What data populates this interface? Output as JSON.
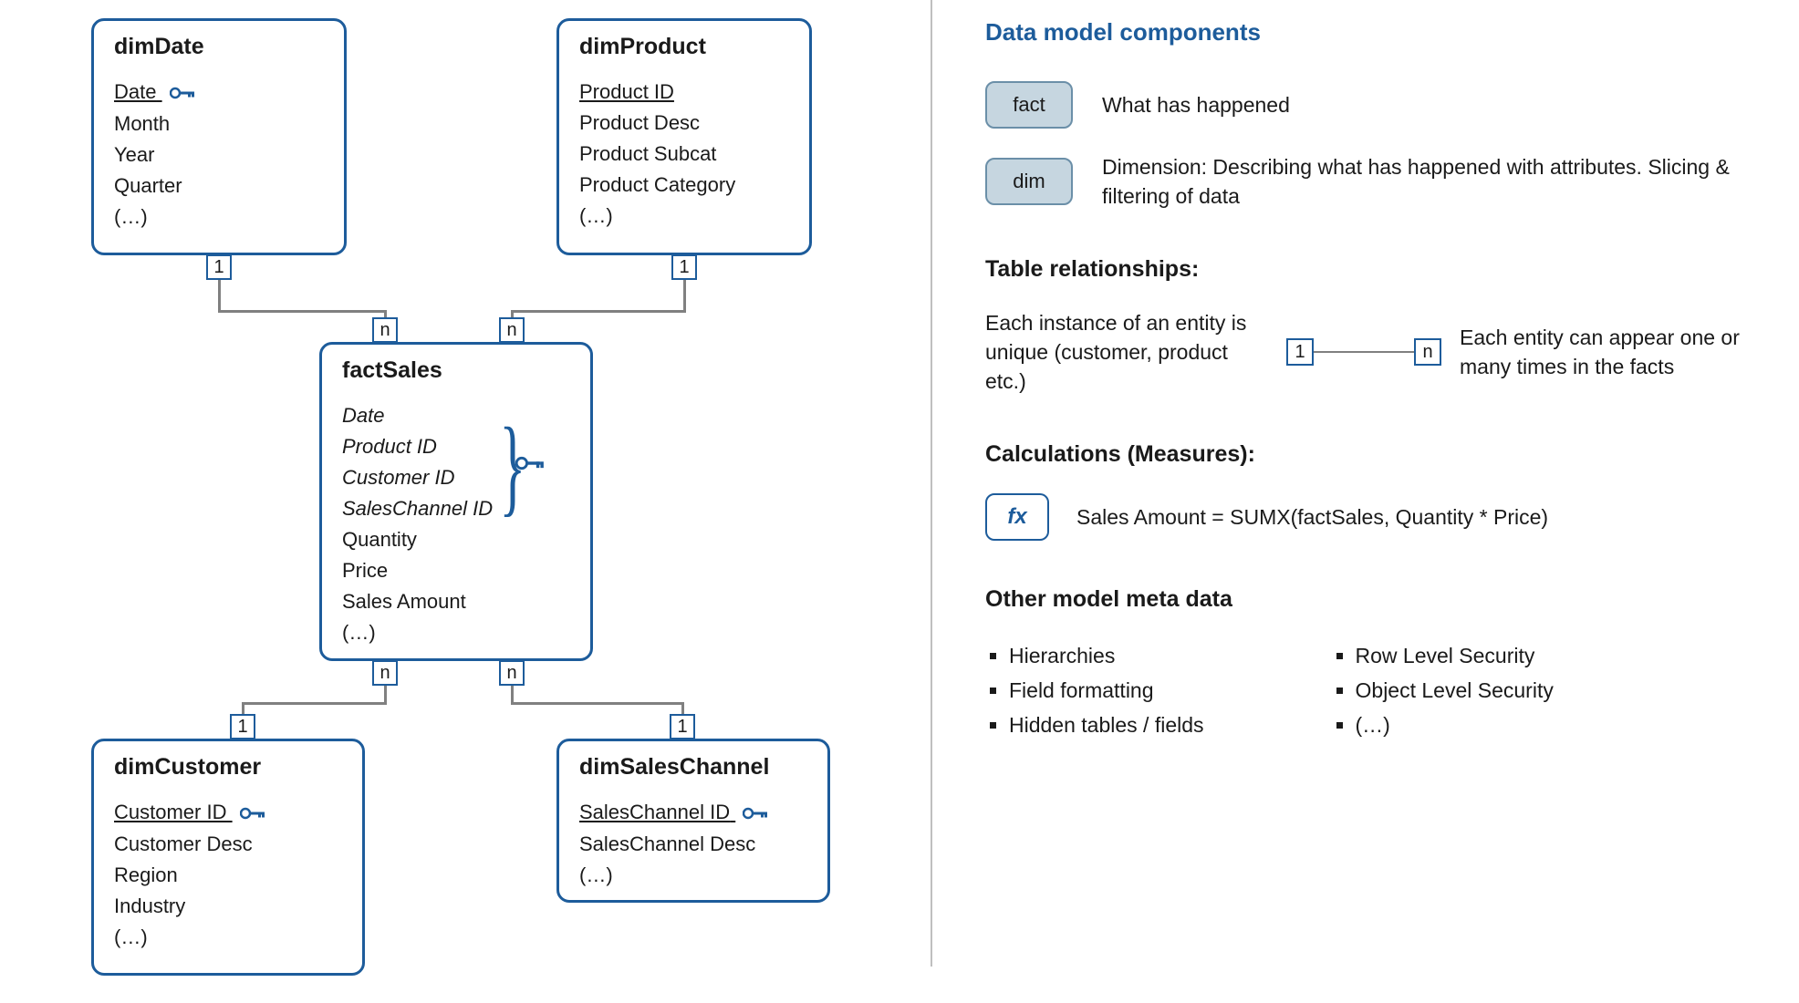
{
  "diagram": {
    "dimDate": {
      "title": "dimDate",
      "key": "Date",
      "fields": [
        "Month",
        "Year",
        "Quarter",
        "(…)"
      ]
    },
    "dimProduct": {
      "title": "dimProduct",
      "key": "Product ID",
      "fields": [
        "Product Desc",
        "Product Subcat",
        "Product Category",
        "(…)"
      ]
    },
    "factSales": {
      "title": "factSales",
      "fk": [
        "Date",
        "Product ID",
        "Customer ID",
        "SalesChannel ID"
      ],
      "fields": [
        "Quantity",
        "Price",
        "Sales Amount",
        "(…)"
      ]
    },
    "dimCustomer": {
      "title": "dimCustomer",
      "key": "Customer ID",
      "fields": [
        "Customer Desc",
        "Region",
        "Industry",
        "(…)"
      ]
    },
    "dimSalesChannel": {
      "title": "dimSalesChannel",
      "key": "SalesChannel ID",
      "fields": [
        "SalesChannel Desc",
        "(…)"
      ]
    },
    "cardinality": {
      "one": "1",
      "many": "n"
    }
  },
  "right": {
    "title": "Data model components",
    "components": [
      {
        "badge": "fact",
        "desc": "What has happened"
      },
      {
        "badge": "dim",
        "desc": "Dimension: Describing what has happened with attributes. Slicing & filtering of data"
      }
    ],
    "rel_heading": "Table relationships:",
    "rel_left": "Each instance of an entity is unique (customer, product etc.)",
    "rel_right": "Each entity can appear one or many times in the facts",
    "calc_heading": "Calculations (Measures):",
    "fx_label": "fx",
    "fx_formula": "Sales Amount = SUMX(factSales, Quantity * Price)",
    "meta_heading": "Other model meta data",
    "meta_left": [
      "Hierarchies",
      "Field formatting",
      "Hidden tables / fields"
    ],
    "meta_right": [
      "Row Level Security",
      "Object Level Security",
      "(…)"
    ]
  }
}
